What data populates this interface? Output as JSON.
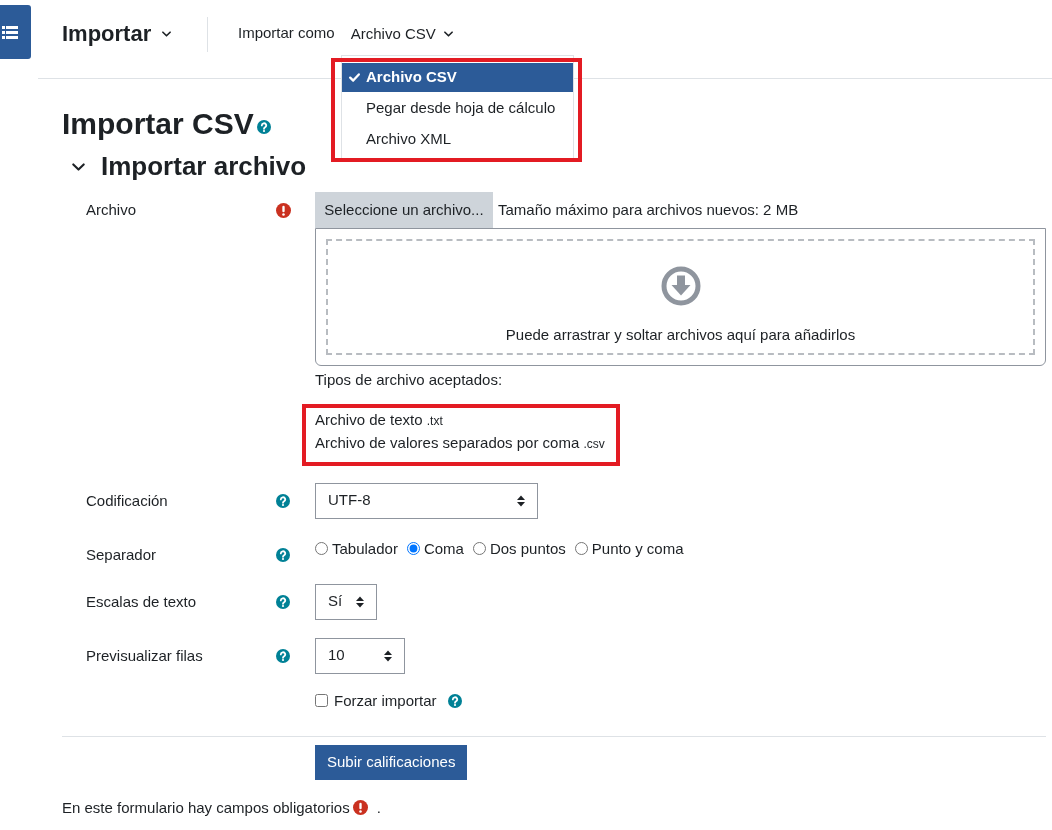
{
  "header": {
    "title": "Importar",
    "label": "Importar como",
    "format_dropdown": {
      "value": "Archivo CSV",
      "expanded": true,
      "highlighted": true,
      "options": [
        {
          "label": "Archivo CSV",
          "selected": true
        },
        {
          "label": "Pegar desde hoja de cálculo",
          "selected": false
        },
        {
          "label": "Archivo XML",
          "selected": false
        }
      ]
    }
  },
  "page_title": {
    "text": "Importar CSV",
    "help": true
  },
  "section": {
    "title": "Importar archivo",
    "expanded": true
  },
  "form": {
    "rows": [
      {
        "kind": "file",
        "label": "Archivo",
        "required": true,
        "button": "Seleccione un archivo...",
        "max_size": "Tamaño máximo para archivos nuevos: 2 MB",
        "drop_hint": "Puede arrastrar y soltar archivos aquí para añadirlos",
        "accepted_label": "Tipos de archivo aceptados:",
        "accepted_types": {
          "highlighted": true,
          "items": [
            {
              "name": "Archivo de texto",
              "extension": ".txt"
            },
            {
              "name": "Archivo de valores separados por coma",
              "extension": ".csv"
            }
          ]
        }
      },
      {
        "kind": "select",
        "label": "Codificación",
        "help": true,
        "value": "UTF-8"
      },
      {
        "kind": "radios",
        "label": "Separador",
        "help": true,
        "options": [
          {
            "label": "Tabulador",
            "selected": false
          },
          {
            "label": "Coma",
            "selected": true
          },
          {
            "label": "Dos puntos",
            "selected": false
          },
          {
            "label": "Punto y coma",
            "selected": false
          }
        ]
      },
      {
        "kind": "select",
        "label": "Escalas de texto",
        "help": true,
        "value": "Sí"
      },
      {
        "kind": "select",
        "label": "Previsualizar filas",
        "help": true,
        "value": "10"
      },
      {
        "kind": "checkbox",
        "text": "Forzar importar",
        "checked": false,
        "help": true
      }
    ]
  },
  "submit_button": "Subir calificaciones",
  "footer": {
    "text": "En este formulario hay campos obligatorios",
    "suffix": "."
  }
}
